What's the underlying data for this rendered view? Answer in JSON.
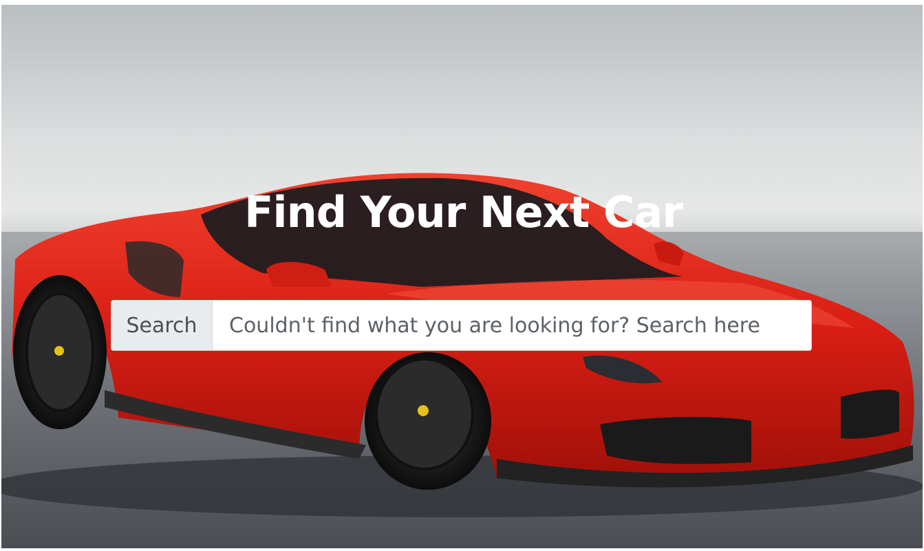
{
  "hero": {
    "title": "Find Your Next Car",
    "background_icon": "red-sports-car-image"
  },
  "search": {
    "addon_label": "Search",
    "placeholder": "Couldn't find what you are looking for? Search here",
    "value": ""
  },
  "colors": {
    "title_text": "#ffffff",
    "car_red": "#e0241b",
    "addon_bg": "#e9ecef",
    "input_border": "#cfd4da"
  }
}
